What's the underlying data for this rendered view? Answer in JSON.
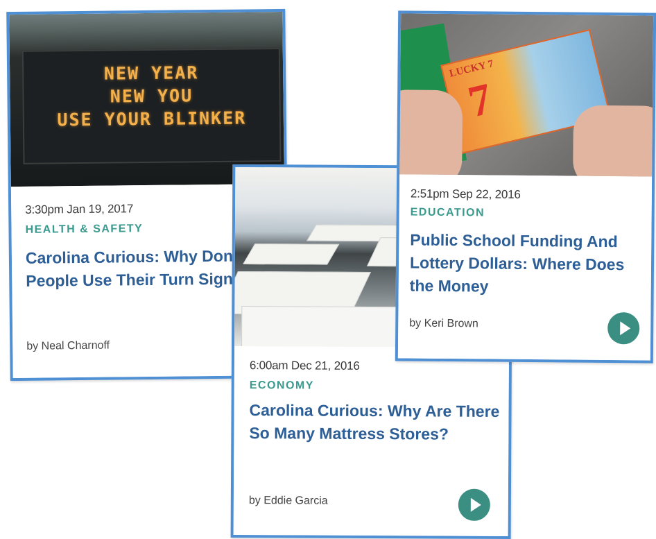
{
  "cards": [
    {
      "sign_lines": [
        "NEW YEAR",
        "NEW YOU",
        "USE YOUR BLINKER"
      ],
      "time": "3:30pm Jan 19, 2017",
      "category": "HEALTH & SAFETY",
      "headline": "Carolina Curious: Why Don't People Use Their Turn Signals?",
      "byline": "by Neal Charnoff"
    },
    {
      "time": "2:51pm Sep 22, 2016",
      "category": "EDUCATION",
      "headline": "Public School Funding And Lottery Dollars: Where Does the Money",
      "byline": "by Keri Brown",
      "ticket_title": "LUCKY 7",
      "ticket_number": "7"
    },
    {
      "time": "6:00am Dec 21, 2016",
      "category": "ECONOMY",
      "headline": "Carolina Curious: Why Are There So Many Mattress Stores?",
      "byline": "by Eddie Garcia"
    }
  ],
  "colors": {
    "accent_border": "#4f8fd3",
    "headline": "#2d5e96",
    "category": "#3a9a8e",
    "play_button": "#3a8f82"
  },
  "icons": [
    "play-icon"
  ]
}
